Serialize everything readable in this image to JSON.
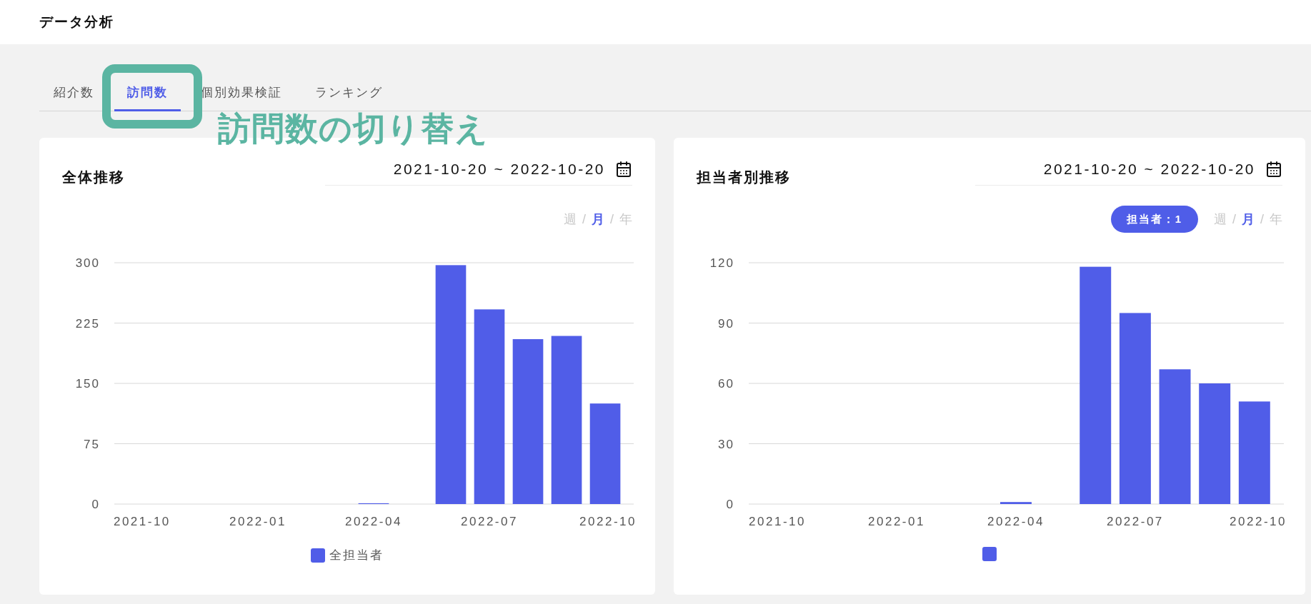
{
  "header": {
    "title": "データ分析"
  },
  "tabs": [
    {
      "label": "紹介数",
      "selected": false
    },
    {
      "label": "訪問数",
      "selected": true
    },
    {
      "label": "個別効果検証",
      "selected": false
    },
    {
      "label": "ランキング",
      "selected": false
    }
  ],
  "annotation": {
    "text": "訪問数の切り替え"
  },
  "cards": [
    {
      "title": "全体推移",
      "date_range": "2021-10-20 ~ 2022-10-20",
      "periods": [
        {
          "label": "週",
          "selected": false
        },
        {
          "label": "月",
          "selected": true
        },
        {
          "label": "年",
          "selected": false
        }
      ],
      "separators": [
        "/",
        "/"
      ],
      "chart_data": {
        "type": "bar",
        "categories": [
          "2021-10",
          null,
          null,
          "2022-01",
          null,
          null,
          "2022-04",
          null,
          null,
          "2022-07",
          null,
          null,
          "2022-10"
        ],
        "ylim": [
          0,
          300
        ],
        "grid": true,
        "yticks": [
          0,
          75,
          150,
          225,
          300
        ],
        "series": [
          {
            "name": "全担当者",
            "color": "#505de8",
            "values": [
              0,
              0,
              0,
              0,
              0,
              0,
              1,
              0,
              297,
              242,
              205,
              209,
              125
            ]
          }
        ]
      }
    },
    {
      "title": "担当者別推移",
      "date_range": "2021-10-20 ~ 2022-10-20",
      "filter": "担当者：1",
      "periods": [
        {
          "label": "週",
          "selected": false
        },
        {
          "label": "月",
          "selected": true
        },
        {
          "label": "年",
          "selected": false
        }
      ],
      "separators": [
        "/",
        "/"
      ],
      "chart_data": {
        "type": "bar",
        "categories": [
          "2021-10",
          null,
          null,
          "2022-01",
          null,
          null,
          "2022-04",
          null,
          null,
          "2022-07",
          null,
          null,
          "2022-10"
        ],
        "ylim": [
          0,
          120
        ],
        "grid": true,
        "yticks": [
          0,
          30,
          60,
          90,
          120
        ],
        "series": [
          {
            "color": "#505de8",
            "values": [
              0,
              0,
              0,
              0,
              0,
              0,
              1,
              0,
              118,
              95,
              67,
              60,
              51
            ]
          }
        ]
      }
    }
  ]
}
